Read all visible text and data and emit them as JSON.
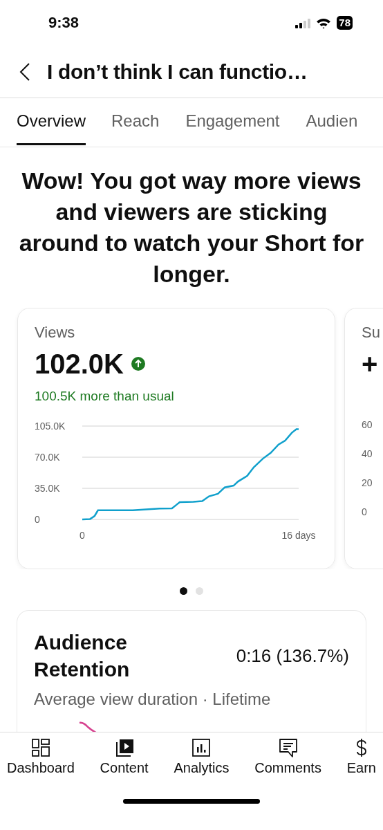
{
  "status_bar": {
    "time": "9:38",
    "battery": "78"
  },
  "header": {
    "title": "I don’t think I can functio…"
  },
  "tabs": [
    {
      "label": "Overview",
      "selected": true
    },
    {
      "label": "Reach",
      "selected": false
    },
    {
      "label": "Engagement",
      "selected": false
    },
    {
      "label": "Audien",
      "selected": false
    }
  ],
  "headline": "Wow! You got way more views and viewers are sticking around to watch your Short for longer.",
  "cards": [
    {
      "title": "Views",
      "value": "102.0K",
      "trend_up": true,
      "note": "100.5K more than usual",
      "chart_data": {
        "type": "line",
        "x": [
          0,
          0.58,
          0.91,
          1.16,
          3.73,
          5.72,
          6.63,
          7.21,
          8.21,
          8.87,
          9.37,
          10.03,
          10.53,
          11.19,
          11.52,
          12.19,
          12.68,
          13.35,
          13.93,
          14.51,
          15.0,
          15.5,
          15.83,
          16
        ],
        "series": [
          {
            "color": "#10a0cc",
            "values": [
              0,
              500,
              3900,
              10300,
              10300,
              12200,
              12500,
              19400,
              19900,
              20500,
              26000,
              28800,
              36000,
              38000,
              42700,
              49000,
              58700,
              68400,
              74800,
              84200,
              88700,
              97500,
              101400,
              101400
            ]
          }
        ],
        "xlim": [
          0,
          16
        ],
        "ylim": [
          0,
          105000
        ],
        "xticks": [
          {
            "value": 0,
            "label": "0"
          },
          {
            "value": 16,
            "label": "16 days"
          }
        ],
        "yticks": [
          {
            "value": 0,
            "label": "0"
          },
          {
            "value": 35000,
            "label": "35.0K"
          },
          {
            "value": 70000,
            "label": "70.0K"
          },
          {
            "value": 105000,
            "label": "105.0K"
          }
        ]
      }
    },
    {
      "title": "Su",
      "value": "+",
      "tick_labels": [
        "60",
        "40",
        "20",
        "0"
      ]
    }
  ],
  "pager": [
    {
      "selected": true
    },
    {
      "selected": false
    }
  ],
  "retention": {
    "title": "Audience Retention",
    "value": "0:16 (136.7%)",
    "subtitle": "Average view duration · Lifetime"
  },
  "nav": [
    {
      "label": "Dashboard"
    },
    {
      "label": "Content"
    },
    {
      "label": "Analytics"
    },
    {
      "label": "Comments"
    },
    {
      "label": "Earn"
    }
  ]
}
